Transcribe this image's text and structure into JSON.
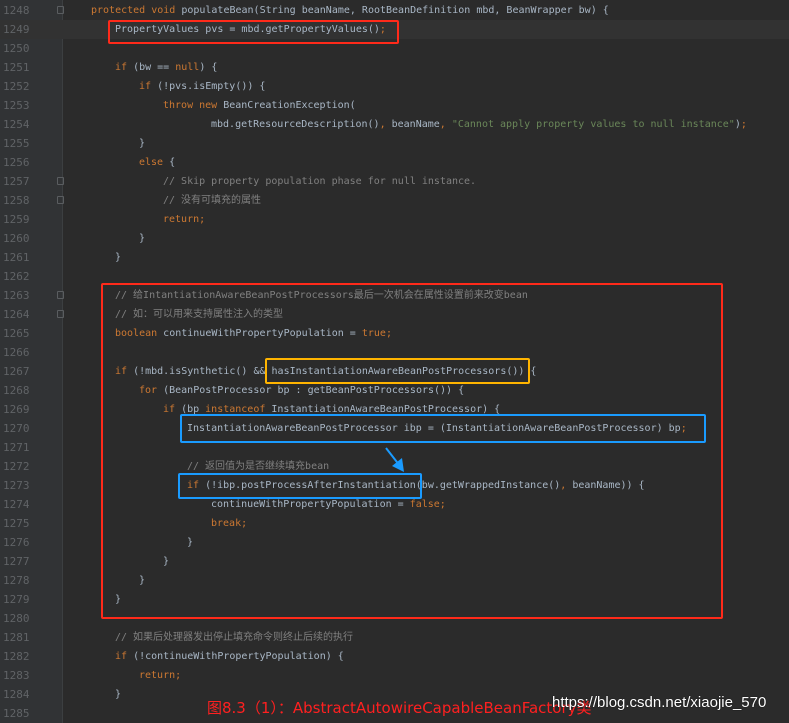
{
  "editor": {
    "colors": {
      "background": "#2b2b2b",
      "gutter": "#313335",
      "keyword": "#cc7832",
      "text": "#a9b7c6",
      "string": "#6a8759",
      "comment": "#808080",
      "line_number": "#606366"
    },
    "current_line": 1249,
    "lines": [
      {
        "n": "1248",
        "indent": 0,
        "fold": true,
        "tokens": [
          [
            "kw",
            "protected void "
          ],
          [
            "tx",
            "populateBean(String beanName, RootBeanDefinition mbd, BeanWrapper bw) {"
          ]
        ]
      },
      {
        "n": "1249",
        "indent": 1,
        "tokens": [
          [
            "tx",
            "PropertyValues pvs = mbd.getPropertyValues()"
          ],
          [
            "kw",
            ";"
          ]
        ]
      },
      {
        "n": "1250",
        "indent": 0,
        "tokens": []
      },
      {
        "n": "1251",
        "indent": 1,
        "tokens": [
          [
            "kw",
            "if "
          ],
          [
            "tx",
            "(bw == "
          ],
          [
            "kw",
            "null"
          ],
          [
            "tx",
            ") {"
          ]
        ]
      },
      {
        "n": "1252",
        "indent": 2,
        "tokens": [
          [
            "kw",
            "if "
          ],
          [
            "tx",
            "(!pvs.isEmpty()) {"
          ]
        ]
      },
      {
        "n": "1253",
        "indent": 3,
        "tokens": [
          [
            "kw",
            "throw new "
          ],
          [
            "tx",
            "BeanCreationException("
          ]
        ]
      },
      {
        "n": "1254",
        "indent": 5,
        "tokens": [
          [
            "tx",
            "mbd.getResourceDescription()"
          ],
          [
            "kw",
            ", "
          ],
          [
            "tx",
            "beanName"
          ],
          [
            "kw",
            ", "
          ],
          [
            "str",
            "\"Cannot apply property values to null instance\""
          ],
          [
            "tx",
            ")"
          ],
          [
            "kw",
            ";"
          ]
        ]
      },
      {
        "n": "1255",
        "indent": 2,
        "tokens": [
          [
            "tx",
            "}"
          ]
        ]
      },
      {
        "n": "1256",
        "indent": 2,
        "tokens": [
          [
            "kw",
            "else "
          ],
          [
            "tx",
            "{"
          ]
        ]
      },
      {
        "n": "1257",
        "indent": 3,
        "fold": true,
        "tokens": [
          [
            "cm",
            "// Skip property population phase for null instance."
          ]
        ]
      },
      {
        "n": "1258",
        "indent": 3,
        "fold": true,
        "tokens": [
          [
            "cm",
            "// 没有可填充的属性"
          ]
        ]
      },
      {
        "n": "1259",
        "indent": 3,
        "tokens": [
          [
            "kw",
            "return;"
          ]
        ]
      },
      {
        "n": "1260",
        "indent": 2,
        "tokens": [
          [
            "tx",
            "}"
          ]
        ]
      },
      {
        "n": "1261",
        "indent": 1,
        "tokens": [
          [
            "tx",
            "}"
          ]
        ]
      },
      {
        "n": "1262",
        "indent": 0,
        "tokens": []
      },
      {
        "n": "1263",
        "indent": 1,
        "fold": true,
        "tokens": [
          [
            "cm",
            "// 给IntantiationAwareBeanPostProcessors最后一次机会在属性设置前来改变bean"
          ]
        ]
      },
      {
        "n": "1264",
        "indent": 1,
        "fold": true,
        "tokens": [
          [
            "cm",
            "// 如：可以用来支持属性注入的类型"
          ]
        ]
      },
      {
        "n": "1265",
        "indent": 1,
        "tokens": [
          [
            "kw",
            "boolean "
          ],
          [
            "tx",
            "continueWithPropertyPopulation = "
          ],
          [
            "kw",
            "true;"
          ]
        ]
      },
      {
        "n": "1266",
        "indent": 0,
        "tokens": []
      },
      {
        "n": "1267",
        "indent": 1,
        "tokens": [
          [
            "kw",
            "if "
          ],
          [
            "tx",
            "(!mbd.isSynthetic() && hasInstantiationAwareBeanPostProcessors()) {"
          ]
        ]
      },
      {
        "n": "1268",
        "indent": 2,
        "tokens": [
          [
            "kw",
            "for "
          ],
          [
            "tx",
            "(BeanPostProcessor bp : getBeanPostProcessors()) {"
          ]
        ]
      },
      {
        "n": "1269",
        "indent": 3,
        "tokens": [
          [
            "kw",
            "if "
          ],
          [
            "tx",
            "(bp "
          ],
          [
            "kw",
            "instanceof "
          ],
          [
            "tx",
            "InstantiationAwareBeanPostProcessor) {"
          ]
        ]
      },
      {
        "n": "1270",
        "indent": 4,
        "tokens": [
          [
            "tx",
            "InstantiationAwareBeanPostProcessor ibp = (InstantiationAwareBeanPostProcessor) bp"
          ],
          [
            "kw",
            ";"
          ]
        ]
      },
      {
        "n": "1271",
        "indent": 0,
        "tokens": []
      },
      {
        "n": "1272",
        "indent": 4,
        "tokens": [
          [
            "cm",
            "// 返回值为是否继续填充bean"
          ]
        ]
      },
      {
        "n": "1273",
        "indent": 4,
        "tokens": [
          [
            "kw",
            "if "
          ],
          [
            "tx",
            "(!ibp.postProcessAfterInstantiation(bw.getWrappedInstance()"
          ],
          [
            "kw",
            ", "
          ],
          [
            "tx",
            "beanName)) {"
          ]
        ]
      },
      {
        "n": "1274",
        "indent": 5,
        "tokens": [
          [
            "tx",
            "continueWithPropertyPopulation = "
          ],
          [
            "kw",
            "false;"
          ]
        ]
      },
      {
        "n": "1275",
        "indent": 5,
        "tokens": [
          [
            "kw",
            "break;"
          ]
        ]
      },
      {
        "n": "1276",
        "indent": 4,
        "tokens": [
          [
            "tx",
            "}"
          ]
        ]
      },
      {
        "n": "1277",
        "indent": 3,
        "tokens": [
          [
            "tx",
            "}"
          ]
        ]
      },
      {
        "n": "1278",
        "indent": 2,
        "tokens": [
          [
            "tx",
            "}"
          ]
        ]
      },
      {
        "n": "1279",
        "indent": 1,
        "tokens": [
          [
            "tx",
            "}"
          ]
        ]
      },
      {
        "n": "1280",
        "indent": 0,
        "tokens": []
      },
      {
        "n": "1281",
        "indent": 1,
        "tokens": [
          [
            "cm",
            "// 如果后处理器发出停止填充命令则终止后续的执行"
          ]
        ]
      },
      {
        "n": "1282",
        "indent": 1,
        "tokens": [
          [
            "kw",
            "if "
          ],
          [
            "tx",
            "(!continueWithPropertyPopulation) {"
          ]
        ]
      },
      {
        "n": "1283",
        "indent": 2,
        "tokens": [
          [
            "kw",
            "return;"
          ]
        ]
      },
      {
        "n": "1284",
        "indent": 1,
        "tokens": [
          [
            "tx",
            "}"
          ]
        ]
      },
      {
        "n": "1285",
        "indent": 0,
        "tokens": []
      }
    ]
  },
  "annotations": {
    "red_color": "#ff2a1a",
    "orange_color": "#ffb400",
    "blue_color": "#1a9bff"
  },
  "caption": "图8.3（1）：AbstractAutowireCapableBeanFactory类",
  "watermark": "https://blog.csdn.net/xiaojie_570"
}
